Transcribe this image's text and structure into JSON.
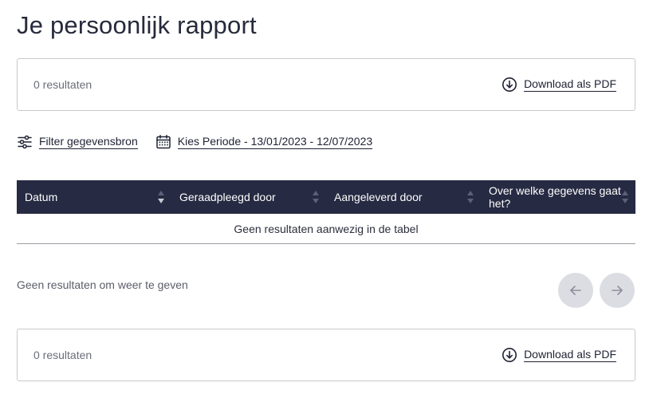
{
  "page": {
    "title": "Je persoonlijk rapport"
  },
  "top_bar": {
    "result_count": "0 resultaten",
    "download_label": "Download als PDF"
  },
  "filters": {
    "source_label": "Filter gegevensbron",
    "period_label": "Kies Periode - 13/01/2023 - 12/07/2023"
  },
  "table": {
    "columns": [
      {
        "label": "Datum"
      },
      {
        "label": "Geraadpleegd door"
      },
      {
        "label": "Aangeleverd door"
      },
      {
        "label": "Over welke gegevens gaat het?"
      }
    ],
    "empty_message": "Geen resultaten aanwezig in de tabel"
  },
  "pagination": {
    "info": "Geen resultaten om weer te geven",
    "prev_icon": "arrow-left-icon",
    "next_icon": "arrow-right-icon"
  },
  "bottom_bar": {
    "result_count": "0 resultaten",
    "download_label": "Download als PDF"
  },
  "icons": {
    "download": "download-circle-icon",
    "filter": "sliders-icon",
    "calendar": "calendar-icon",
    "sort": "sort-icon"
  },
  "colors": {
    "header_bg": "#262a42",
    "text": "#1f2233",
    "muted": "#6b6d78",
    "pager_bg": "#dcdde3"
  }
}
